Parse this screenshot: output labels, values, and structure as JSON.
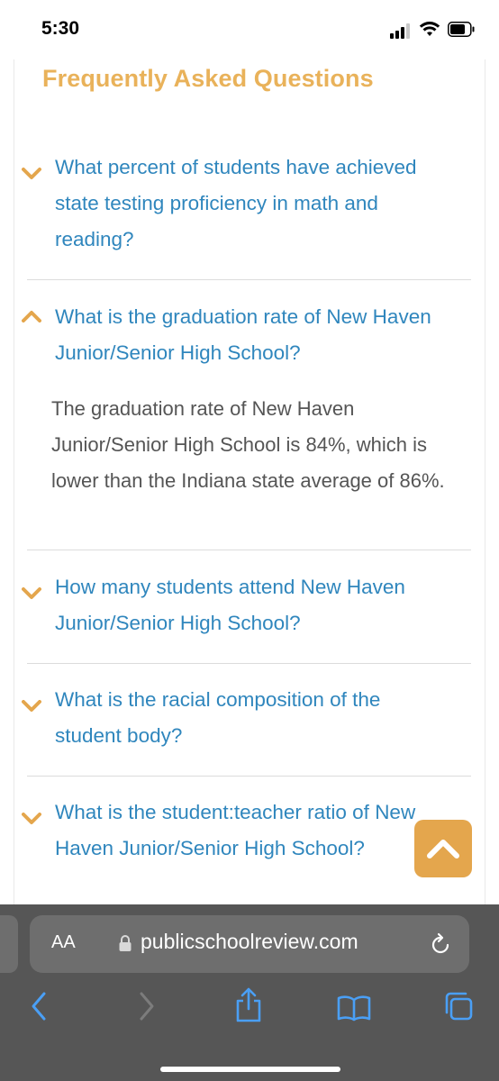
{
  "status": {
    "time": "5:30"
  },
  "faq": {
    "title": "Frequently Asked Questions",
    "items": [
      {
        "question": "What percent of students have achieved state testing proficiency in math and reading?",
        "expanded": false
      },
      {
        "question": "What is the graduation rate of New Haven Junior/Senior High School?",
        "expanded": true,
        "answer": "The graduation rate of New Haven Junior/Senior High School is 84%, which is lower than the Indiana state average of 86%."
      },
      {
        "question": "How many students attend New Haven Junior/Senior High School?",
        "expanded": false
      },
      {
        "question": "What is the racial composition of the student body?",
        "expanded": false
      },
      {
        "question": "What is the student:teacher ratio of New Haven Junior/Senior High School?",
        "expanded": false
      }
    ]
  },
  "browser": {
    "aa_label": "AA",
    "url": "publicschoolreview.com"
  },
  "colors": {
    "accent": "#e9b25a",
    "link": "#2f86bd",
    "scroll_button": "#e4a64d"
  }
}
